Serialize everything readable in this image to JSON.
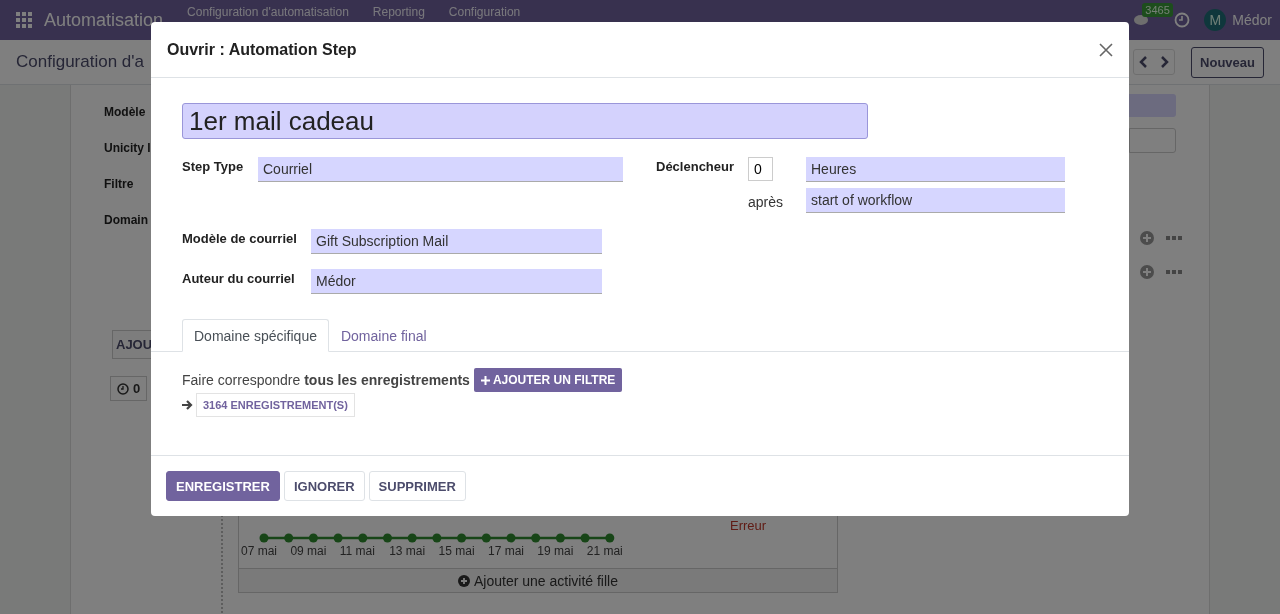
{
  "navbar": {
    "app_name": "Automatisation",
    "menus": [
      "Configuration d'automatisation",
      "Reporting",
      "Configuration"
    ],
    "message_count": "3465",
    "avatar_initial": "M",
    "user": "Médor"
  },
  "control_panel": {
    "title": "Configuration d'a",
    "new_button": "Nouveau"
  },
  "background_form": {
    "labels": [
      "Modèle",
      "Unicity l",
      "Filtre",
      "Domain"
    ],
    "add_button": "AJOU",
    "counter": "0",
    "status": "Erreur",
    "timeline_labels": [
      "07 mai",
      "09 mai",
      "11 mai",
      "13 mai",
      "15 mai",
      "17 mai",
      "19 mai",
      "21 mai"
    ],
    "add_child": "Ajouter une activité fille"
  },
  "dialog": {
    "title": "Ouvrir : Automation Step",
    "name": "1er mail cadeau",
    "fields": [
      {
        "label": "Step Type",
        "value": "Courriel"
      },
      {
        "label": "Modèle de courriel",
        "value": "Gift Subscription Mail"
      },
      {
        "label": "Auteur du courriel",
        "value": "Médor"
      }
    ],
    "trigger": {
      "label": "Déclencheur",
      "amount": "0",
      "unit": "Heures",
      "after_label": "après",
      "reference": "start of workflow"
    },
    "tabs": [
      {
        "label": "Domaine spécifique",
        "selected": true
      },
      {
        "label": "Domaine final",
        "selected": false
      }
    ],
    "domain": {
      "text": "Faire correspondre **tous les enregistrements**",
      "add_filter": "AJOUTER UN FILTRE",
      "records": "3164 ENREGISTREMENT(S)"
    },
    "buttons": [
      {
        "label": "ENREGISTRER",
        "kind": "primary"
      },
      {
        "label": "IGNORER",
        "kind": "secondary"
      },
      {
        "label": "SUPPRIMER",
        "kind": "secondary"
      }
    ]
  }
}
